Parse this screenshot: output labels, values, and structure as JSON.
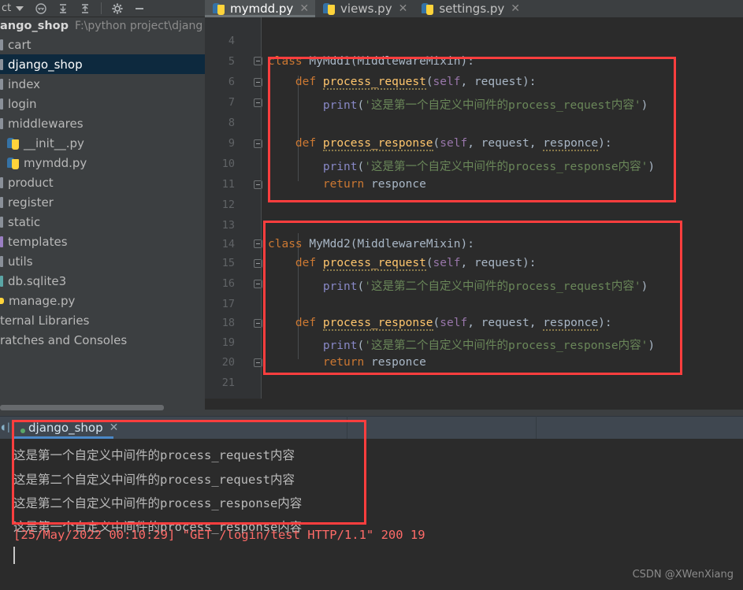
{
  "toolbar": {
    "project_label": "ct",
    "caret_icon": "chevron-down-icon",
    "icons": [
      "locate-icon",
      "collapse-all-icon",
      "expand-all-icon",
      "settings-gear-icon",
      "hide-icon"
    ]
  },
  "project": {
    "name": "ango_shop",
    "path": "F:\\python project\\djang"
  },
  "sidebar": {
    "items": [
      {
        "label": "cart",
        "type": "folder",
        "selected": false
      },
      {
        "label": "django_shop",
        "type": "folder",
        "selected": true
      },
      {
        "label": "index",
        "type": "folder",
        "selected": false
      },
      {
        "label": "login",
        "type": "folder",
        "selected": false
      },
      {
        "label": "middlewares",
        "type": "folder",
        "selected": false
      },
      {
        "label": "__init__.py",
        "type": "python",
        "selected": false
      },
      {
        "label": "mymdd.py",
        "type": "python",
        "selected": false
      },
      {
        "label": "product",
        "type": "folder",
        "selected": false
      },
      {
        "label": "register",
        "type": "folder",
        "selected": false
      },
      {
        "label": "static",
        "type": "folder",
        "selected": false
      },
      {
        "label": "templates",
        "type": "folder-purple",
        "selected": false
      },
      {
        "label": "utils",
        "type": "folder",
        "selected": false
      },
      {
        "label": "db.sqlite3",
        "type": "db",
        "selected": false
      },
      {
        "label": "manage.py",
        "type": "manage",
        "selected": false
      },
      {
        "label": "ternal Libraries",
        "type": "plain",
        "selected": false
      },
      {
        "label": "ratches and Consoles",
        "type": "plain",
        "selected": false
      }
    ]
  },
  "editor": {
    "tabs": [
      {
        "label": "mymdd.py",
        "active": true,
        "close_icon": "close-icon"
      },
      {
        "label": "views.py",
        "active": false,
        "close_icon": "close-icon"
      },
      {
        "label": "settings.py",
        "active": false,
        "close_icon": "close-icon"
      }
    ],
    "line_numbers": [
      "4",
      "5",
      "6",
      "7",
      "8",
      "9",
      "10",
      "11",
      "12",
      "13",
      "14",
      "15",
      "16",
      "17",
      "18",
      "19",
      "20",
      "21"
    ],
    "code_lines": [
      {
        "n": "4",
        "text": ""
      },
      {
        "n": "5",
        "text": "class MyMdd1(MiddlewareMixin):"
      },
      {
        "n": "6",
        "text": "    def process_request(self, request):"
      },
      {
        "n": "7",
        "text": "        print('这是第一个自定义中间件的process_request内容')"
      },
      {
        "n": "8",
        "text": ""
      },
      {
        "n": "9",
        "text": "    def process_response(self, request, responce):"
      },
      {
        "n": "10",
        "text": "        print('这是第一个自定义中间件的process_response内容')"
      },
      {
        "n": "11",
        "text": "        return responce"
      },
      {
        "n": "12",
        "text": ""
      },
      {
        "n": "13",
        "text": ""
      },
      {
        "n": "14",
        "text": "class MyMdd2(MiddlewareMixin):"
      },
      {
        "n": "15",
        "text": "    def process_request(self, request):"
      },
      {
        "n": "16",
        "text": "        print('这是第二个自定义中间件的process_request内容')"
      },
      {
        "n": "17",
        "text": ""
      },
      {
        "n": "18",
        "text": "    def process_response(self, request, responce):"
      },
      {
        "n": "19",
        "text": "        print('这是第二个自定义中间件的process_response内容')"
      },
      {
        "n": "20",
        "text": "        return responce"
      },
      {
        "n": "21",
        "text": ""
      }
    ],
    "tokens": {
      "kw_class": "class",
      "kw_def": "def",
      "kw_return": "return",
      "cls1": "MyMdd1",
      "cls2": "MyMdd2",
      "base": "MiddlewareMixin",
      "fn_req": "process_request",
      "fn_resp": "process_response",
      "self": "self",
      "p_request": "request",
      "p_responce": "responce",
      "builtin_print": "print",
      "str_1_req": "'这是第一个自定义中间件的process_request内容'",
      "str_1_resp": "'这是第一个自定义中间件的process_response内容'",
      "str_2_req": "'这是第二个自定义中间件的process_request内容'",
      "str_2_resp": "'这是第二个自定义中间件的process_response内容'"
    }
  },
  "console": {
    "tab": {
      "label": "django_shop",
      "close_icon": "close-icon",
      "status": "running"
    },
    "output_lines": [
      "这是第一个自定义中间件的process_request内容",
      "这是第二个自定义中间件的process_request内容",
      "这是第二个自定义中间件的process_response内容",
      "这是第一个自定义中间件的process_response内容"
    ],
    "log_line": "[25/May/2022 00:10:29] \"GET /login/test HTTP/1.1\" 200 19"
  },
  "watermark": "CSDN @XWenXiang",
  "colors": {
    "annotation_red": "#FF3E3E",
    "keyword": "#CC7832",
    "function": "#FFC66D",
    "string": "#6A8759",
    "builtin": "#8888C6",
    "self": "#9876AA",
    "plain": "#A9B7C6",
    "editor_bg": "#2b2b2b",
    "ui_bg": "#3c3f41",
    "selection": "#0d293e",
    "console_tab_bg": "#3f4750",
    "error_red": "#FF6B68",
    "accent_blue": "#4a88c7"
  }
}
